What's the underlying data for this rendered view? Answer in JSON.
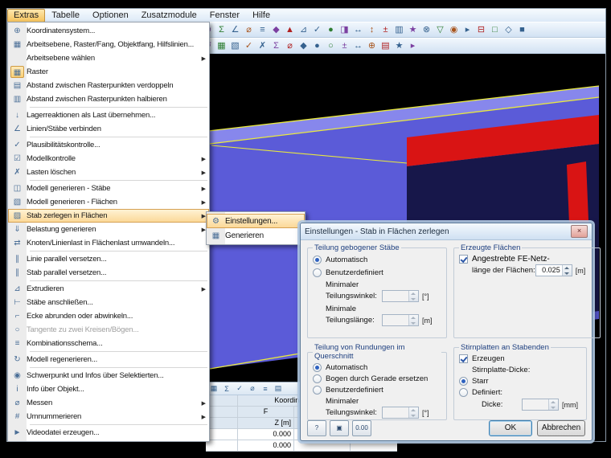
{
  "menubar": {
    "items": [
      {
        "label": "Extras",
        "active": true
      },
      {
        "label": "Tabelle"
      },
      {
        "label": "Optionen"
      },
      {
        "label": "Zusatzmodule"
      },
      {
        "label": "Fenster"
      },
      {
        "label": "Hilfe"
      }
    ]
  },
  "toolbar1": {
    "icons": [
      "▤",
      "▼",
      "◫",
      "▦",
      "▧",
      "⊞",
      "↺",
      "↻",
      "✂",
      "▣",
      "◧",
      "⇄",
      "⇅",
      "▦",
      "⊕",
      "Σ",
      "∠",
      "⌀",
      "≡",
      "◆",
      "▲",
      "⊿",
      "✓",
      "●",
      "◨",
      "↔",
      "↕",
      "±",
      "▥",
      "★",
      "⊗",
      "▽",
      "◉",
      "▸",
      "⊟",
      "□",
      "◇",
      "■"
    ]
  },
  "toolbar2": {
    "icons": [
      "□",
      "▣",
      "◇",
      "⊞",
      "⊟",
      "≡",
      "∥",
      "∠",
      "⌂",
      "▲",
      "▼",
      "◐",
      "◑",
      "⇄",
      "↺",
      "▦",
      "▧",
      "✓",
      "✗",
      "Σ",
      "⌀",
      "◆",
      "●",
      "○",
      "±",
      "↔",
      "⊕",
      "▤",
      "★",
      "▸"
    ]
  },
  "menu": {
    "items": [
      {
        "icon": "⊕",
        "label": "Koordinatensystem..."
      },
      {
        "icon": "▦",
        "label": "Arbeitsebene, Raster/Fang, Objektfang, Hilfslinien..."
      },
      {
        "icon": "",
        "label": "Arbeitsebene wählen",
        "sub": true
      },
      {
        "icon": "▦",
        "label": "Raster",
        "boxed": true
      },
      {
        "icon": "▤",
        "label": "Abstand zwischen Rasterpunkten verdoppeln"
      },
      {
        "icon": "▥",
        "label": "Abstand zwischen Rasterpunkten halbieren"
      },
      {
        "sep": true
      },
      {
        "icon": "↓",
        "label": "Lagerreaktionen als Last übernehmen..."
      },
      {
        "icon": "∠",
        "label": "Linien/Stäbe verbinden"
      },
      {
        "sep": true
      },
      {
        "icon": "✓",
        "label": "Plausibilitätskontrolle..."
      },
      {
        "icon": "☑",
        "label": "Modellkontrolle",
        "sub": true
      },
      {
        "icon": "✗",
        "label": "Lasten löschen",
        "sub": true
      },
      {
        "sep": true
      },
      {
        "icon": "◫",
        "label": "Modell generieren - Stäbe",
        "sub": true
      },
      {
        "icon": "▧",
        "label": "Modell generieren - Flächen",
        "sub": true
      },
      {
        "icon": "▨",
        "label": "Stab zerlegen in Flächen",
        "sub": true,
        "hot": true
      },
      {
        "icon": "⇓",
        "label": "Belastung generieren",
        "sub": true
      },
      {
        "icon": "⇄",
        "label": "Knoten/Linienlast in Flächenlast umwandeln..."
      },
      {
        "sep": true
      },
      {
        "icon": "∥",
        "label": "Linie parallel versetzen..."
      },
      {
        "icon": "∥",
        "label": "Stab parallel versetzen..."
      },
      {
        "sep": true
      },
      {
        "icon": "⊿",
        "label": "Extrudieren",
        "sub": true
      },
      {
        "icon": "⊢",
        "label": "Stäbe anschließen..."
      },
      {
        "icon": "⌐",
        "label": "Ecke abrunden oder abwinkeln..."
      },
      {
        "icon": "○",
        "label": "Tangente zu zwei Kreisen/Bögen...",
        "gray": true
      },
      {
        "icon": "≡",
        "label": "Kombinationsschema..."
      },
      {
        "sep": true
      },
      {
        "icon": "↻",
        "label": "Modell regenerieren..."
      },
      {
        "sep": true
      },
      {
        "icon": "◉",
        "label": "Schwerpunkt und Infos über Selektierten..."
      },
      {
        "icon": "i",
        "label": "Info über Objekt..."
      },
      {
        "icon": "⌀",
        "label": "Messen",
        "sub": true
      },
      {
        "icon": "#",
        "label": "Umnummerieren",
        "sub": true
      },
      {
        "sep": true
      },
      {
        "icon": "►",
        "label": "Videodatei erzeugen..."
      }
    ]
  },
  "submenu": {
    "items": [
      {
        "icon": "⚙",
        "label": "Einstellungen...",
        "hot": true
      },
      {
        "icon": "▦",
        "label": "Generieren"
      }
    ]
  },
  "dialog": {
    "title": "Einstellungen - Stab in Flächen zerlegen",
    "group_bent": {
      "title": "Teilung gebogener Stäbe",
      "auto": "Automatisch",
      "user": "Benutzerdefiniert",
      "angle_l1": "Minimaler",
      "angle_l2": "Teilungswinkel:",
      "angle_unit": "[°]",
      "len_l1": "Minimale",
      "len_l2": "Teilungslänge:",
      "len_unit": "[m]"
    },
    "group_surfaces": {
      "title": "Erzeugte Flächen",
      "fe_l1": "Angestrebte FE-Netz-",
      "fe_l2": "länge der Flächen:",
      "fe_value": "0.025",
      "fe_unit": "[m]"
    },
    "group_round": {
      "title": "Teilung von Rundungen im Querschnitt",
      "auto": "Automatisch",
      "arc": "Bogen durch Gerade ersetzen",
      "user": "Benutzerdefiniert",
      "angle_l1": "Minimaler",
      "angle_l2": "Teilungswinkel:",
      "angle_unit": "[°]"
    },
    "group_end": {
      "title": "Stirnplatten an Stabenden",
      "create": "Erzeugen",
      "thick_label": "Stirnplatte-Dicke:",
      "rigid": "Starr",
      "defined": "Definiert:",
      "thick": "Dicke:",
      "thick_unit": "[mm]"
    },
    "small_buttons": [
      "?",
      "▣",
      "0.00"
    ],
    "ok": "OK",
    "cancel": "Abbrechen"
  },
  "table": {
    "toolbar_icons": [
      "▦",
      "Σ",
      "✓",
      "⌀",
      "≡",
      "▤"
    ],
    "title": "Koordinaten",
    "col_letter": "F",
    "sub_header": "Z [m]",
    "values": [
      "0.000",
      "0.000"
    ]
  },
  "viewport": {
    "colors": {
      "background": "#000000",
      "beam_top": "#8787ec",
      "beam_face": "#5b5bd8",
      "beam_shadow": "#17174a",
      "cross_section": "#d91414",
      "edge": "#e9e93e"
    }
  }
}
